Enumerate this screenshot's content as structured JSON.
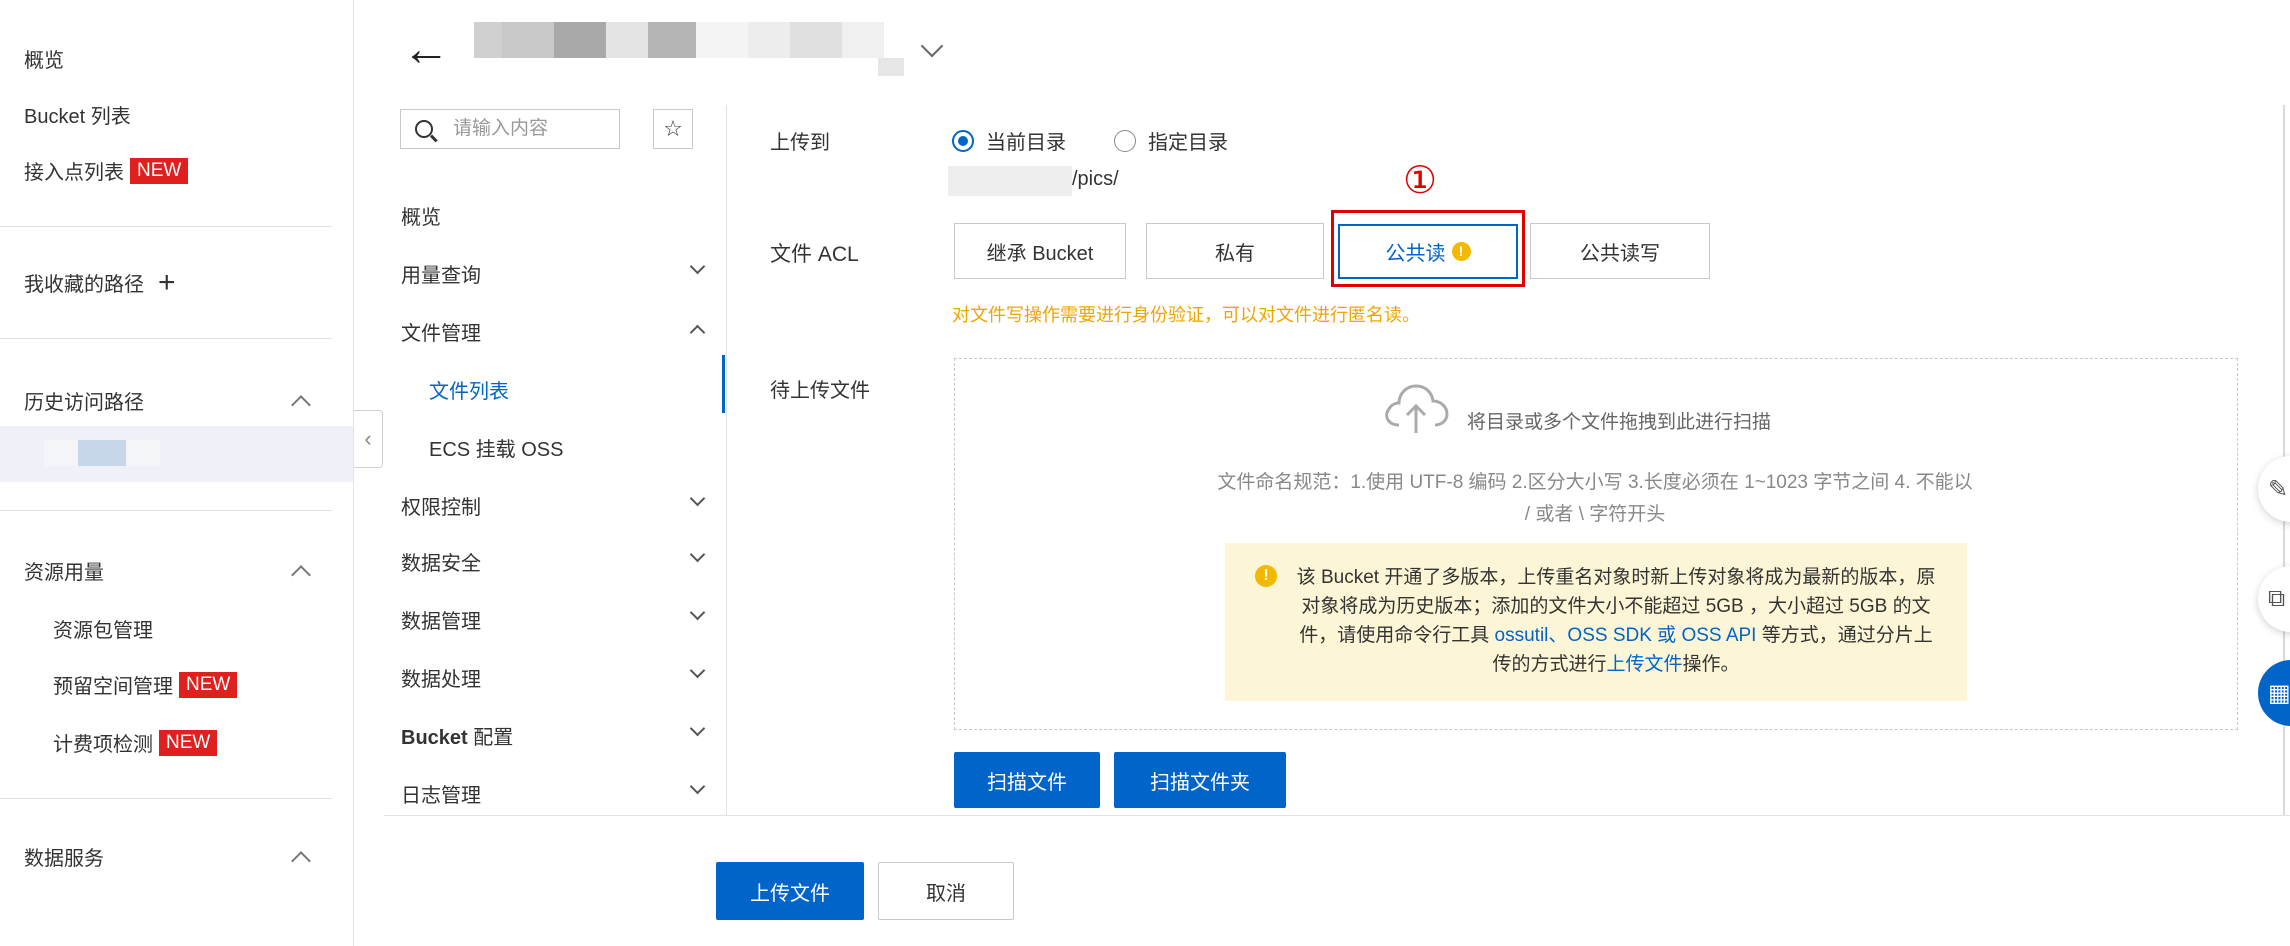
{
  "sidebar": {
    "overview": "概览",
    "bucket_list": "Bucket 列表",
    "access_points": "接入点列表",
    "new_badge": "NEW",
    "favorites": "我收藏的路径",
    "favorites_add": "+",
    "history": "历史访问路径",
    "resource_usage": "资源用量",
    "resource_pack": "资源包管理",
    "reserved_space": "预留空间管理",
    "billing_check": "计费项检测",
    "data_services": "数据服务"
  },
  "header": {
    "back_icon": "←"
  },
  "bucket_nav": {
    "search_placeholder": "请输入内容",
    "fav_icon": "☆",
    "items": {
      "overview": "概览",
      "usage_query": "用量查询",
      "file_mgmt": "文件管理",
      "file_list": "文件列表",
      "ecs_mount": "ECS 挂载 OSS",
      "access_control": "权限控制",
      "data_security": "数据安全",
      "data_mgmt": "数据管理",
      "data_processing": "数据处理",
      "bucket_config_bold": "Bucket",
      "bucket_config_rest": " 配置",
      "log_mgmt": "日志管理"
    }
  },
  "form": {
    "upload_to_label": "上传到",
    "radio_current": "当前目录",
    "radio_specified": "指定目录",
    "path_suffix": "/pics/",
    "acl_label": "文件 ACL",
    "acl_options": [
      "继承 Bucket",
      "私有",
      "公共读",
      "公共读写"
    ],
    "acl_selected": "公共读",
    "acl_warn_icon": "!",
    "acl_hint": "对文件写操作需要进行身份验证，可以对文件进行匿名读。",
    "step_marker": "①",
    "pending_label": "待上传文件",
    "drop_hint": "将目录或多个文件拖拽到此进行扫描",
    "naming_rules": "文件命名规范：1.使用 UTF-8 编码 2.区分大小写 3.长度必须在 1~1023 字节之间 4. 不能以 / 或者 \\ 字符开头",
    "notice_icon": "!",
    "notice_text_1": "该 Bucket 开通了多版本，上传重名对象时新上传对象将成为最新的版本，原对象将成为历史版本；添加的文件大小不能超过 5GB ，大小超过 5GB 的文件，请使用命令行工具 ",
    "notice_link_ossutil": "ossutil",
    "notice_sep": "、",
    "notice_link_sdk": "OSS SDK",
    "notice_or": " 或 ",
    "notice_link_api": "OSS API",
    "notice_text_2": " 等方式，通过分片上传的方式进行",
    "notice_link_upload": "上传文件",
    "notice_text_3": "操作。",
    "scan_files": "扫描文件",
    "scan_folder": "扫描文件夹"
  },
  "footer": {
    "upload": "上传文件",
    "cancel": "取消"
  },
  "colors": {
    "primary": "#0064c8",
    "danger": "#e00000",
    "warning": "#f0a400",
    "badge": "#e0201e"
  }
}
